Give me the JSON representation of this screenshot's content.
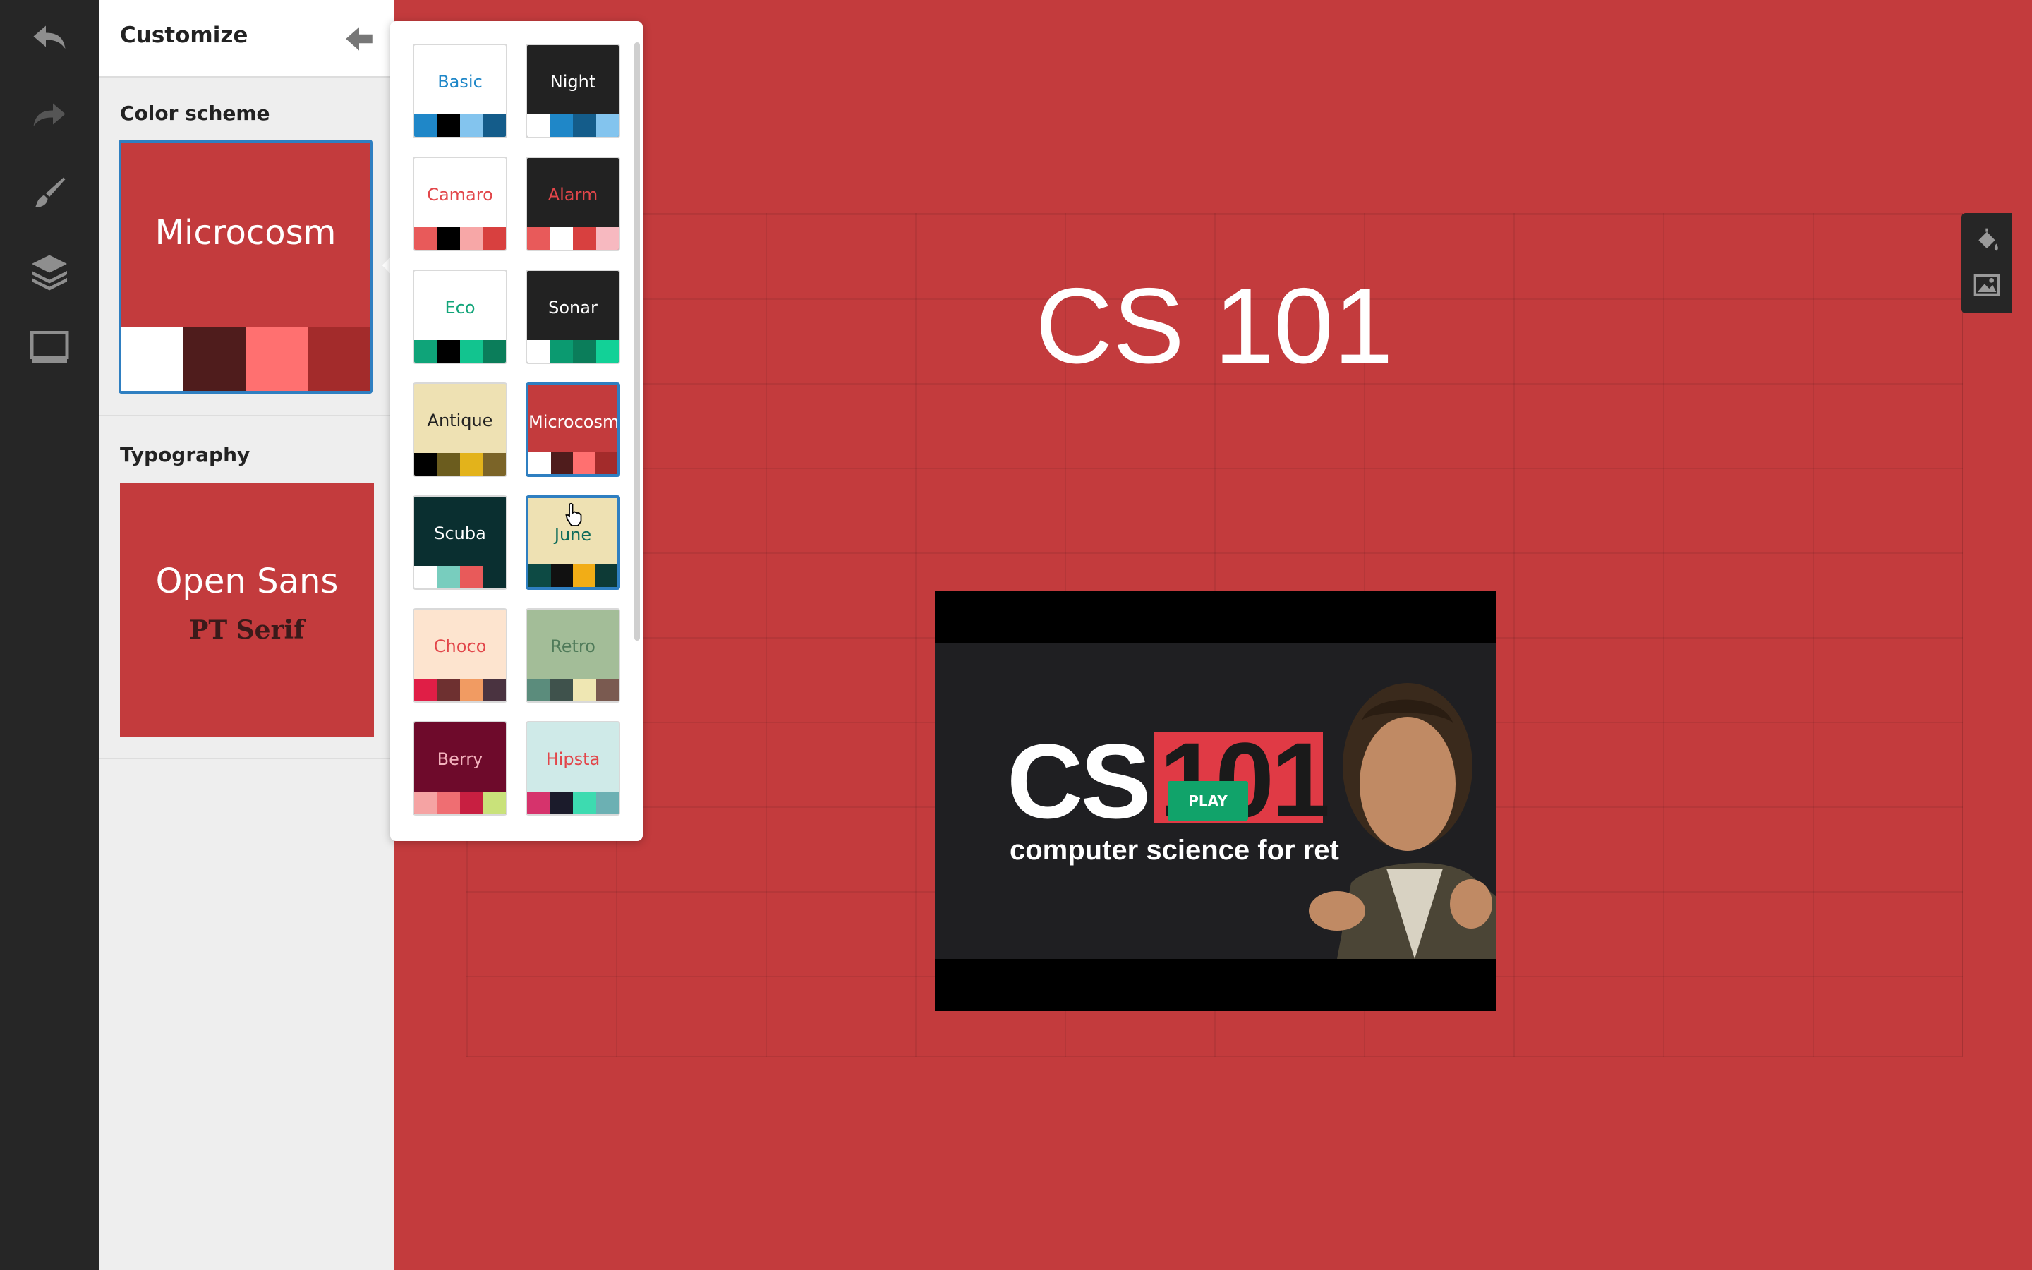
{
  "app": {
    "panel_title": "Customize"
  },
  "toolbar": {
    "items": [
      "undo-icon",
      "redo-icon",
      "brush-icon",
      "layers-icon",
      "monitor-icon"
    ]
  },
  "panel": {
    "color_scheme_label": "Color scheme",
    "selected_scheme": {
      "name": "Microcosm",
      "swatches": [
        "#ffffff",
        "#4f1c1c",
        "#ff7070",
        "#a32b2b"
      ],
      "background": "#c33b3d"
    },
    "typography_label": "Typography",
    "typography": {
      "sans": "Open Sans",
      "serif": "PT Serif"
    }
  },
  "schemes": [
    {
      "name": "Basic",
      "bg": "#ffffff",
      "fg": "#1f87c8",
      "swatches": [
        "#1f87c8",
        "#000000",
        "#83c4ee",
        "#145c8a"
      ]
    },
    {
      "name": "Night",
      "bg": "#222222",
      "fg": "#ffffff",
      "swatches": [
        "#ffffff",
        "#1f87c8",
        "#145c8a",
        "#83c4ee"
      ]
    },
    {
      "name": "Camaro",
      "bg": "#ffffff",
      "fg": "#e2464a",
      "swatches": [
        "#e85a5a",
        "#000000",
        "#f7a7a7",
        "#d8403f"
      ]
    },
    {
      "name": "Alarm",
      "bg": "#222222",
      "fg": "#e2464a",
      "swatches": [
        "#e85a5a",
        "#ffffff",
        "#d8403f",
        "#f7b9c0"
      ]
    },
    {
      "name": "Eco",
      "bg": "#ffffff",
      "fg": "#13a57a",
      "swatches": [
        "#0fa479",
        "#000000",
        "#12c48f",
        "#0b7d5a"
      ]
    },
    {
      "name": "Sonar",
      "bg": "#222222",
      "fg": "#ffffff",
      "swatches": [
        "#ffffff",
        "#0b9a70",
        "#0b7d5a",
        "#12d197"
      ]
    },
    {
      "name": "Antique",
      "bg": "#eee1b3",
      "fg": "#222222",
      "swatches": [
        "#000000",
        "#6b5c1e",
        "#e3b31b",
        "#7b6428"
      ]
    },
    {
      "name": "Microcosm",
      "bg": "#c33b3d",
      "fg": "#ffffff",
      "swatches": [
        "#ffffff",
        "#4f1c1c",
        "#ff7070",
        "#a32b2b"
      ]
    },
    {
      "name": "Scuba",
      "bg": "#0a2f30",
      "fg": "#ffffff",
      "swatches": [
        "#ffffff",
        "#78cdbe",
        "#e85a5a",
        "#0a2f30"
      ]
    },
    {
      "name": "June",
      "bg": "#eee1b3",
      "fg": "#0d6b5a",
      "swatches": [
        "#0d4a44",
        "#111111",
        "#f2ad16",
        "#0d3a36"
      ]
    },
    {
      "name": "Choco",
      "bg": "#fde4cf",
      "fg": "#e2464a",
      "swatches": [
        "#e01e46",
        "#6e3030",
        "#f19b62",
        "#4a3340"
      ]
    },
    {
      "name": "Retro",
      "bg": "#a3bd98",
      "fg": "#4f7a59",
      "swatches": [
        "#5b8c7c",
        "#3f524c",
        "#efe7b3",
        "#7a5a50"
      ]
    },
    {
      "name": "Berry",
      "bg": "#6e0a2b",
      "fg": "#f3b2bd",
      "swatches": [
        "#f5a3a3",
        "#ef6e72",
        "#c81f41",
        "#c9e27a"
      ]
    },
    {
      "name": "Hipsta",
      "bg": "#cfeae8",
      "fg": "#e2464a",
      "swatches": [
        "#d6336c",
        "#1b1b2b",
        "#3ddbb0",
        "#6cb0b3"
      ]
    }
  ],
  "selected_scheme_name": "Microcosm",
  "hovered_scheme_name": "June",
  "slide": {
    "title": "CS 101",
    "video": {
      "big_text": "CS",
      "number": "101",
      "tagline": "computer science for ret",
      "play_label": "PLAY"
    }
  },
  "right_tools": [
    "paint-bucket-icon",
    "image-icon"
  ]
}
